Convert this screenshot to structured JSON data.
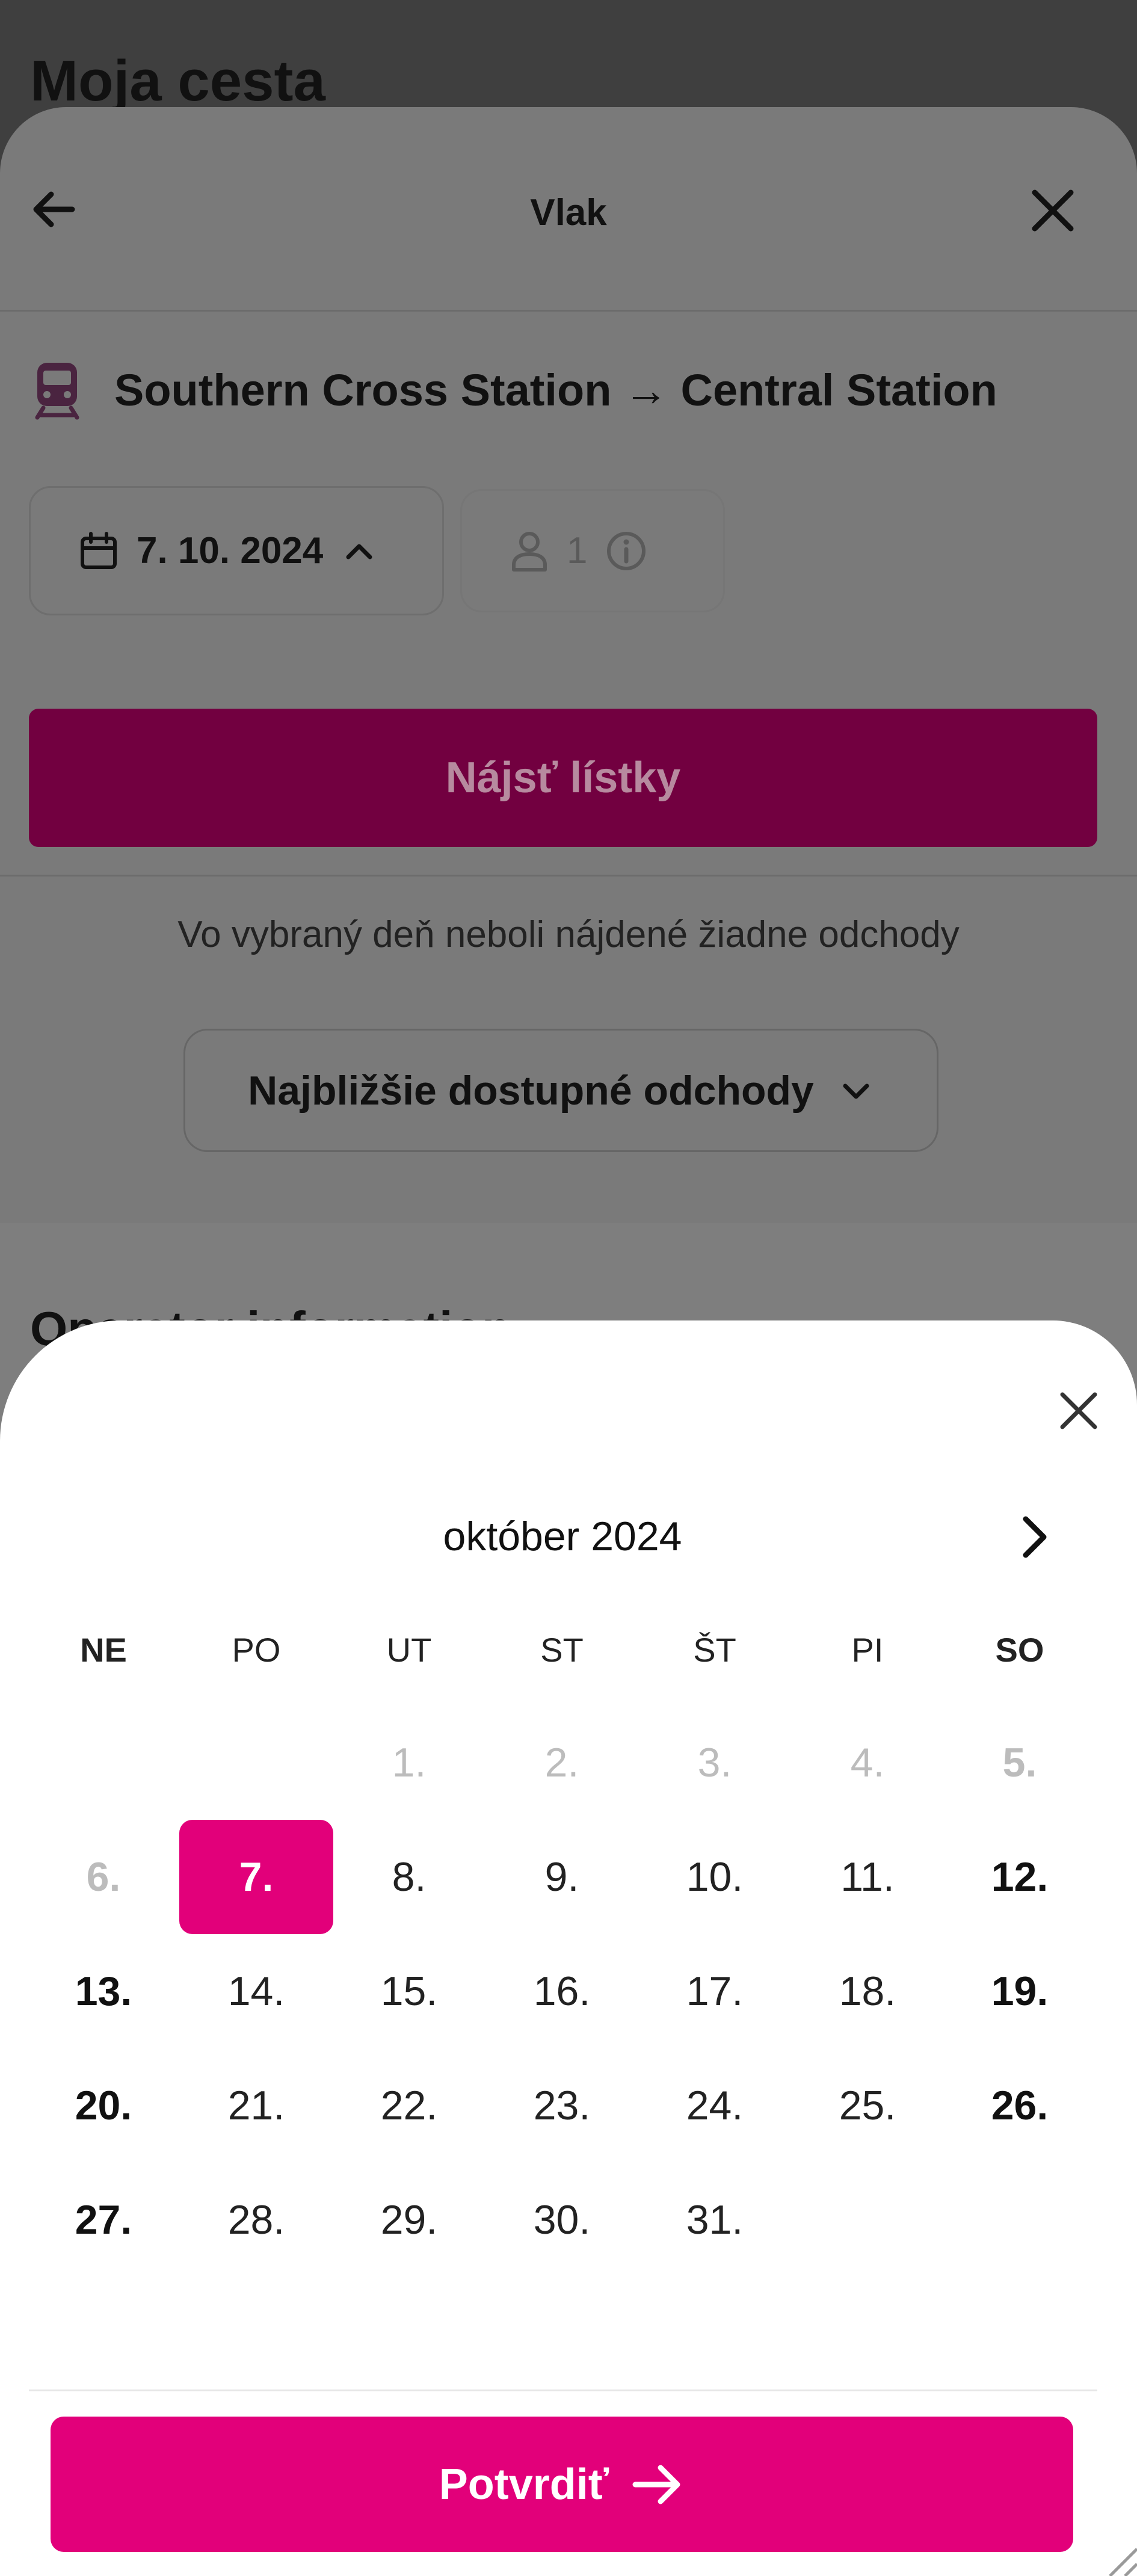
{
  "background": {
    "page_title": "Moja cesta"
  },
  "train_panel": {
    "title": "Vlak",
    "route": "Southern Cross Station → Central Station",
    "date": "7. 10. 2024",
    "passengers": "1",
    "find_button": "Nájsť lístky",
    "no_departures": "Vo vybraný deň neboli nájdené žiadne odchody",
    "nearest_button": "Najbližšie dostupné odchody",
    "operator_info": "Operator information"
  },
  "calendar": {
    "month_label": "október 2024",
    "weekdays": [
      "NE",
      "PO",
      "UT",
      "ST",
      "ŠT",
      "PI",
      "SO"
    ],
    "weeks": [
      [
        "",
        "",
        "1.",
        "2.",
        "3.",
        "4.",
        "5."
      ],
      [
        "6.",
        "7.",
        "8.",
        "9.",
        "10.",
        "11.",
        "12."
      ],
      [
        "13.",
        "14.",
        "15.",
        "16.",
        "17.",
        "18.",
        "19."
      ],
      [
        "20.",
        "21.",
        "22.",
        "23.",
        "24.",
        "25.",
        "26."
      ],
      [
        "27.",
        "28.",
        "29.",
        "30.",
        "31.",
        "",
        ""
      ]
    ],
    "selected_day": "7.",
    "disabled_days": [
      "1.",
      "2.",
      "3.",
      "4.",
      "5.",
      "6."
    ],
    "confirm_button": "Potvrdiť"
  },
  "colors": {
    "accent": "#e2007a",
    "find_button_bg": "#720040",
    "overlay_bg": "#7a7a7a"
  },
  "icons": [
    "back-arrow-icon",
    "close-icon",
    "train-icon",
    "calendar-icon",
    "chevron-up-icon",
    "person-icon",
    "info-icon",
    "chevron-down-icon",
    "chevron-right-icon",
    "arrow-right-icon"
  ]
}
